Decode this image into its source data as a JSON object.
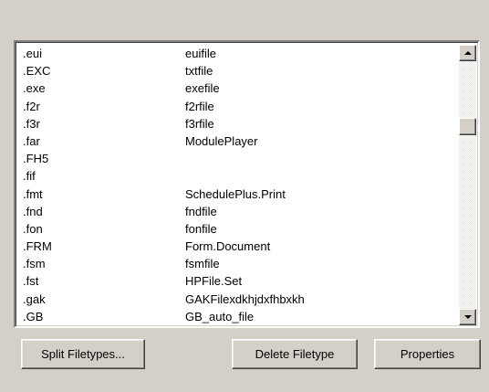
{
  "filetypes": {
    "rows": [
      {
        "ext": ".eui",
        "type": "euifile"
      },
      {
        "ext": ".EXC",
        "type": "txtfile"
      },
      {
        "ext": ".exe",
        "type": "exefile"
      },
      {
        "ext": ".f2r",
        "type": "f2rfile"
      },
      {
        "ext": ".f3r",
        "type": "f3rfile"
      },
      {
        "ext": ".far",
        "type": "ModulePlayer"
      },
      {
        "ext": ".FH5",
        "type": ""
      },
      {
        "ext": ".fif",
        "type": ""
      },
      {
        "ext": ".fmt",
        "type": "SchedulePlus.Print"
      },
      {
        "ext": ".fnd",
        "type": "fndfile"
      },
      {
        "ext": ".fon",
        "type": "fonfile"
      },
      {
        "ext": ".FRM",
        "type": "Form.Document"
      },
      {
        "ext": ".fsm",
        "type": "fsmfile"
      },
      {
        "ext": ".fst",
        "type": "HPFile.Set"
      },
      {
        "ext": ".gak",
        "type": "GAKFilexdkhjdxfhbxkh"
      },
      {
        "ext": ".GB",
        "type": "GB_auto_file"
      }
    ]
  },
  "scrollbar": {
    "up_icon": "arrow-up-icon",
    "down_icon": "arrow-down-icon"
  },
  "buttons": {
    "split": "Split Filetypes...",
    "delete": "Delete Filetype",
    "properties": "Properties"
  }
}
